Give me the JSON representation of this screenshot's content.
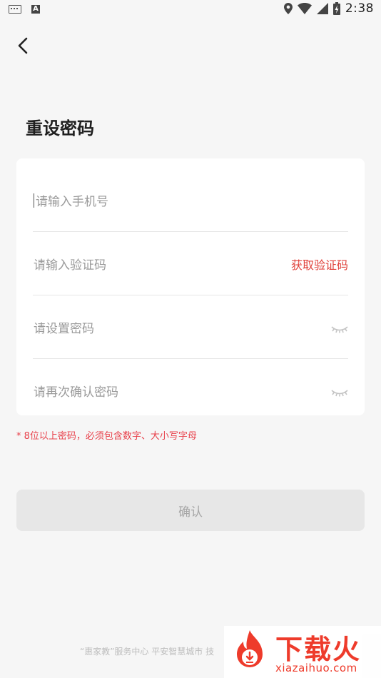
{
  "status_bar": {
    "time": "2:38"
  },
  "header": {
    "title": "重设密码"
  },
  "form": {
    "phone_placeholder": "请输入手机号",
    "code_placeholder": "请输入验证码",
    "get_code_label": "获取验证码",
    "password_placeholder": "请设置密码",
    "confirm_password_placeholder": "请再次确认密码"
  },
  "hint": "* 8位以上密码，必须包含数字、大小写字母",
  "confirm_label": "确认",
  "footer": {
    "text": "“惠家教”服务中心 平安智慧城市 技"
  },
  "watermark": {
    "title": "下载火",
    "domain": "xiazaihuo.com"
  },
  "colors": {
    "accent": "#e0413a",
    "hint": "#e8404a",
    "button_bg": "#e7e7e7"
  }
}
